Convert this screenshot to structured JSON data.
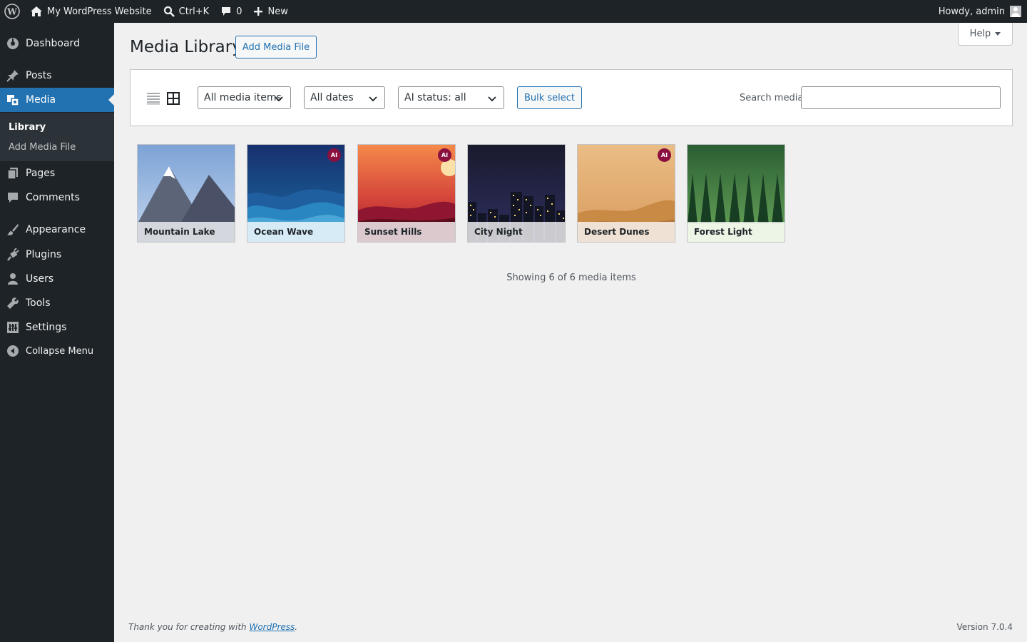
{
  "adminbar": {
    "site_name": "My WordPress Website",
    "search_shortcut": "Ctrl+K",
    "comments_count": "0",
    "new_label": "New",
    "howdy": "Howdy, admin"
  },
  "sidebar": {
    "items": [
      {
        "label": "Dashboard",
        "icon": "dashboard-icon"
      },
      {
        "label": "Posts",
        "icon": "pin-icon"
      },
      {
        "label": "Media",
        "icon": "media-icon"
      },
      {
        "label": "Pages",
        "icon": "pages-icon"
      },
      {
        "label": "Comments",
        "icon": "comment-icon"
      },
      {
        "label": "Appearance",
        "icon": "brush-icon"
      },
      {
        "label": "Plugins",
        "icon": "plugin-icon"
      },
      {
        "label": "Users",
        "icon": "user-icon"
      },
      {
        "label": "Tools",
        "icon": "wrench-icon"
      },
      {
        "label": "Settings",
        "icon": "settings-icon"
      }
    ],
    "submenu": [
      "Library",
      "Add Media File"
    ],
    "collapse_label": "Collapse Menu"
  },
  "header": {
    "title": "Media Library",
    "add_button": "Add Media File",
    "help": "Help"
  },
  "toolbar": {
    "filter_type": "All media items",
    "filter_date": "All dates",
    "filter_ai": "AI status: all",
    "bulk_select": "Bulk select",
    "search_label": "Search media",
    "search_value": ""
  },
  "media": [
    {
      "title": "Mountain Lake",
      "ai": false
    },
    {
      "title": "Ocean Wave",
      "ai": true
    },
    {
      "title": "Sunset Hills",
      "ai": true
    },
    {
      "title": "City Night",
      "ai": false
    },
    {
      "title": "Desert Dunes",
      "ai": true
    },
    {
      "title": "Forest Light",
      "ai": false
    }
  ],
  "ai_badge": "AI",
  "status": "Showing 6 of 6 media items",
  "footer": {
    "thanks_prefix": "Thank you for creating with ",
    "thanks_link": "WordPress",
    "thanks_suffix": ".",
    "version": "Version 7.0.4"
  },
  "colors": {
    "accent": "#2271b1",
    "sidebar_bg": "#1d2327",
    "ai_badge": "#8a1040"
  }
}
